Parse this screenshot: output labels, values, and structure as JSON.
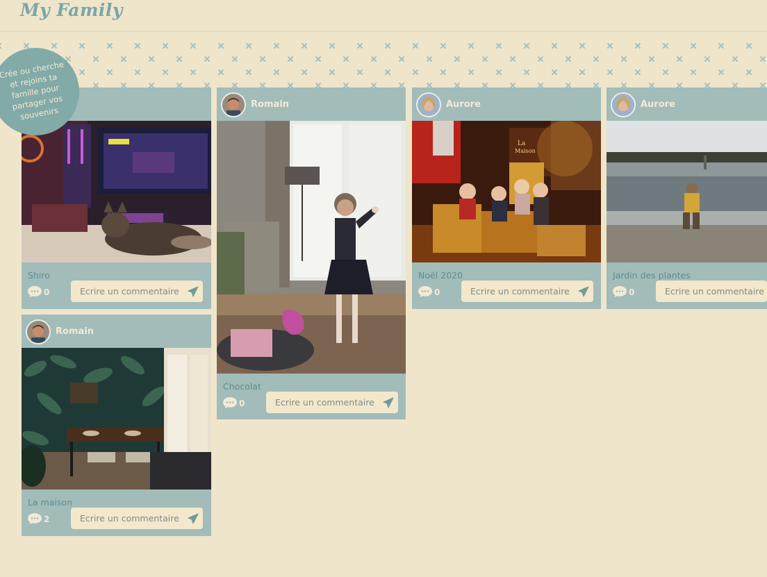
{
  "app": {
    "logo": "My Family"
  },
  "badge": {
    "text": "Crée ou cherche et rejoins ta famille pour partager vos souvenirs"
  },
  "comment_placeholder": "Ecrire un commentaire",
  "posts": [
    {
      "author": "",
      "caption": "Shiro",
      "comments": "0",
      "photo": "cat-gaming-desk"
    },
    {
      "author": "Romain",
      "caption": "Chocolat",
      "comments": "0",
      "photo": "girl-dancing-livingroom"
    },
    {
      "author": "Aurore",
      "caption": "Noël 2020",
      "comments": "0",
      "photo": "children-christmas-presents"
    },
    {
      "author": "Aurore",
      "caption": "Jardin des plantes",
      "comments": "0",
      "photo": "child-by-fountain"
    },
    {
      "author": "Romain",
      "caption": "La maison",
      "comments": "2",
      "photo": "dining-room-jungle-wallpaper"
    }
  ],
  "colors": {
    "background": "#efe5cb",
    "card": "#a2bcb9",
    "accent": "#7aa7a6",
    "badge": "#82aaa7"
  }
}
